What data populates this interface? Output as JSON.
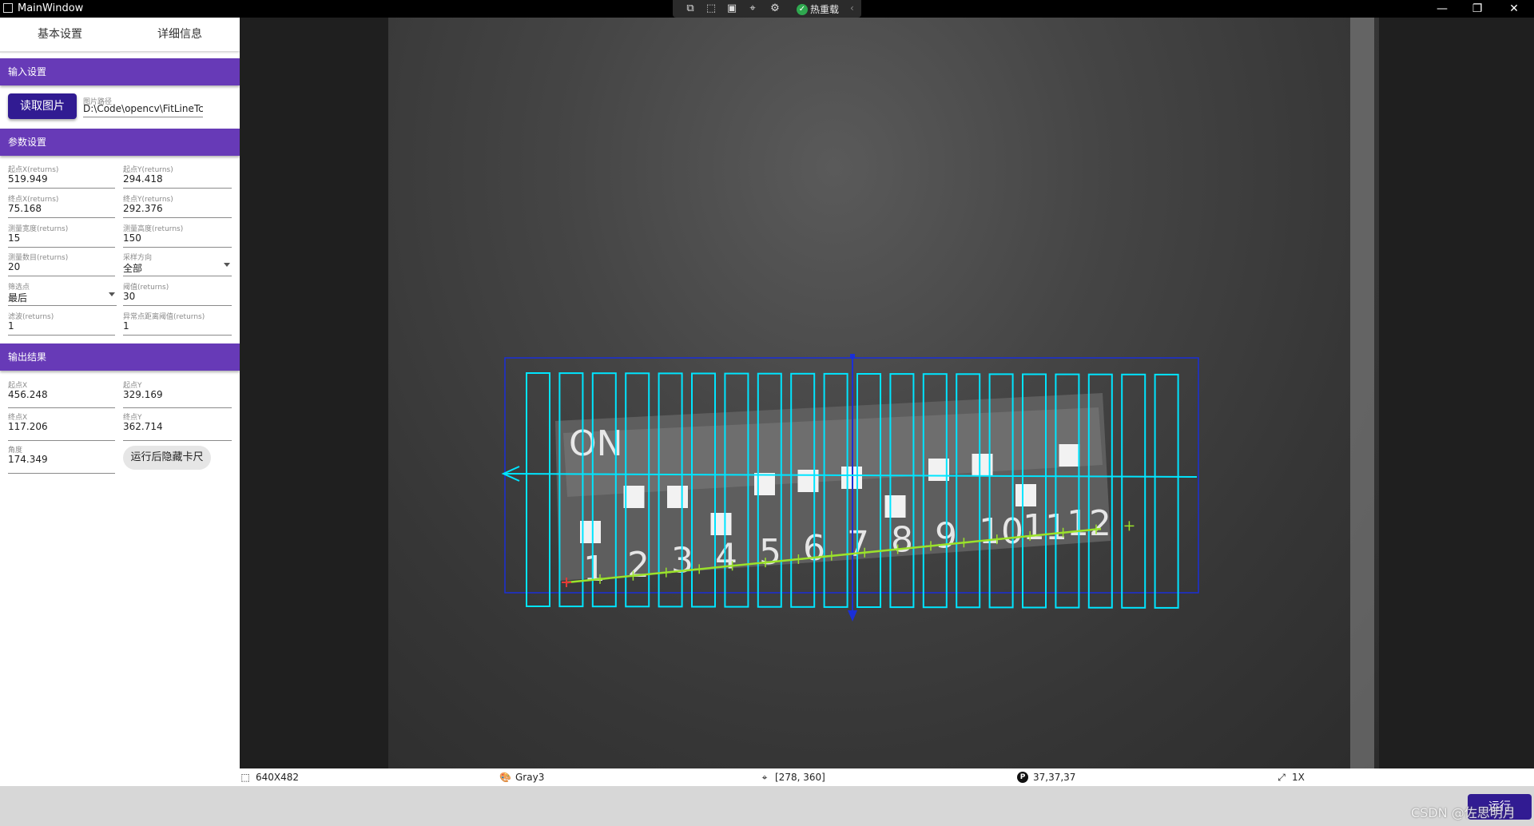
{
  "window": {
    "title": "MainWindow",
    "hot_reload_label": "热重载",
    "controls": {
      "minimize": "—",
      "restore": "❐",
      "close": "✕"
    }
  },
  "tabs": [
    "基本设置",
    "详细信息"
  ],
  "input_section": {
    "title": "输入设置",
    "read_button": "读取图片",
    "path_label": "图片路径",
    "path_value": "D:\\Code\\opencv\\FitLineTc"
  },
  "params_section": {
    "title": "参数设置",
    "fields": [
      {
        "label": "起点X(returns)",
        "value": "519.949"
      },
      {
        "label": "起点Y(returns)",
        "value": "294.418"
      },
      {
        "label": "终点X(returns)",
        "value": "75.168"
      },
      {
        "label": "终点Y(returns)",
        "value": "292.376"
      },
      {
        "label": "测量宽度(returns)",
        "value": "15"
      },
      {
        "label": "测量高度(returns)",
        "value": "150"
      },
      {
        "label": "测量数目(returns)",
        "value": "20"
      },
      {
        "label": "采样方向",
        "value": "全部"
      },
      {
        "label": "筛选点",
        "value": "最后"
      },
      {
        "label": "阈值(returns)",
        "value": "30"
      },
      {
        "label": "滤波(returns)",
        "value": "1"
      },
      {
        "label": "异常点距离阈值(returns)",
        "value": "1"
      }
    ]
  },
  "output_section": {
    "title": "输出结果",
    "fields": [
      {
        "label": "起点X",
        "value": "456.248"
      },
      {
        "label": "起点Y",
        "value": "329.169"
      },
      {
        "label": "终点X",
        "value": "117.206"
      },
      {
        "label": "终点Y",
        "value": "362.714"
      },
      {
        "label": "角度",
        "value": "174.349"
      }
    ],
    "hide_button": "运行后隐藏卡尺"
  },
  "image_labels": {
    "on": "ON",
    "numbers": [
      "1",
      "2",
      "3",
      "4",
      "5",
      "6",
      "7",
      "8",
      "9",
      "10",
      "11",
      "12"
    ]
  },
  "statusbar": {
    "size": "640X482",
    "color_mode": "Gray3",
    "position": "[278, 360]",
    "pixel": "37,37,37",
    "zoom": "1X"
  },
  "run_button": "运行",
  "watermark": "CSDN @佐思明月",
  "colors": {
    "accent": "#673ab7",
    "button_dark": "#311b92",
    "caliper": "#00e5ff",
    "fit_line": "#9be22b",
    "roi": "#1a2fd8"
  }
}
